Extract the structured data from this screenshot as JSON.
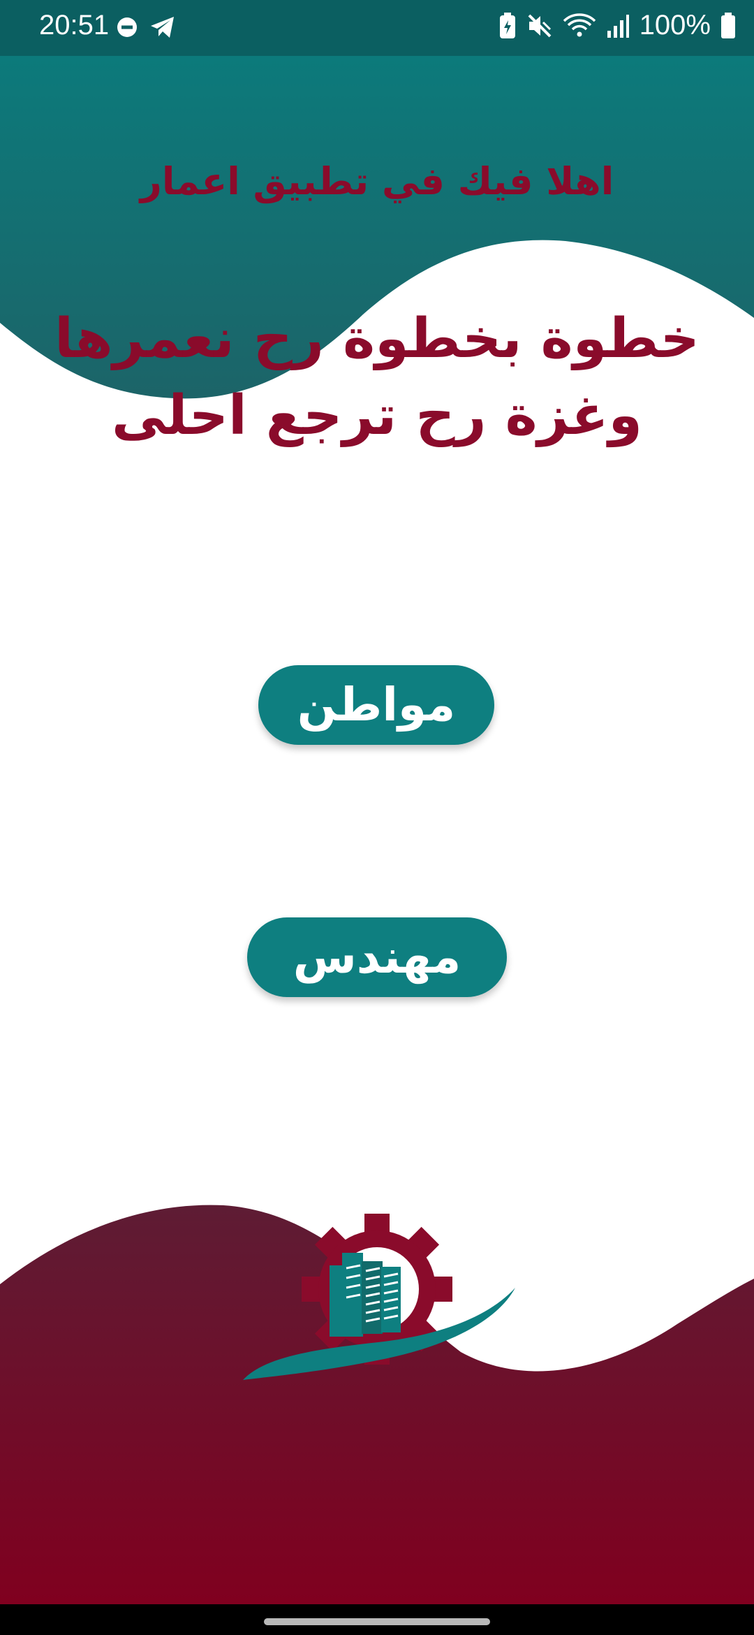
{
  "status_bar": {
    "time": "20:51",
    "battery": "100%",
    "left_icons": [
      "do-not-disturb-icon",
      "telegram-icon"
    ],
    "right_icons": [
      "battery-saver-icon",
      "mute-icon",
      "wifi-icon",
      "signal-icon",
      "battery-icon"
    ]
  },
  "header": {
    "welcome": "اهلا فيك في تطبيق اعمار"
  },
  "slogan": {
    "line1": "خطوة بخطوة رح نعمرها",
    "line2": "وغزة رح ترجع احلى"
  },
  "buttons": {
    "citizen": "مواطن",
    "engineer": "مهندس"
  },
  "colors": {
    "teal": "#0e7f80",
    "maroon": "#8a0b2b",
    "status_bar": "#0b5f61"
  },
  "logo": {
    "icon": "gear-building-logo"
  }
}
